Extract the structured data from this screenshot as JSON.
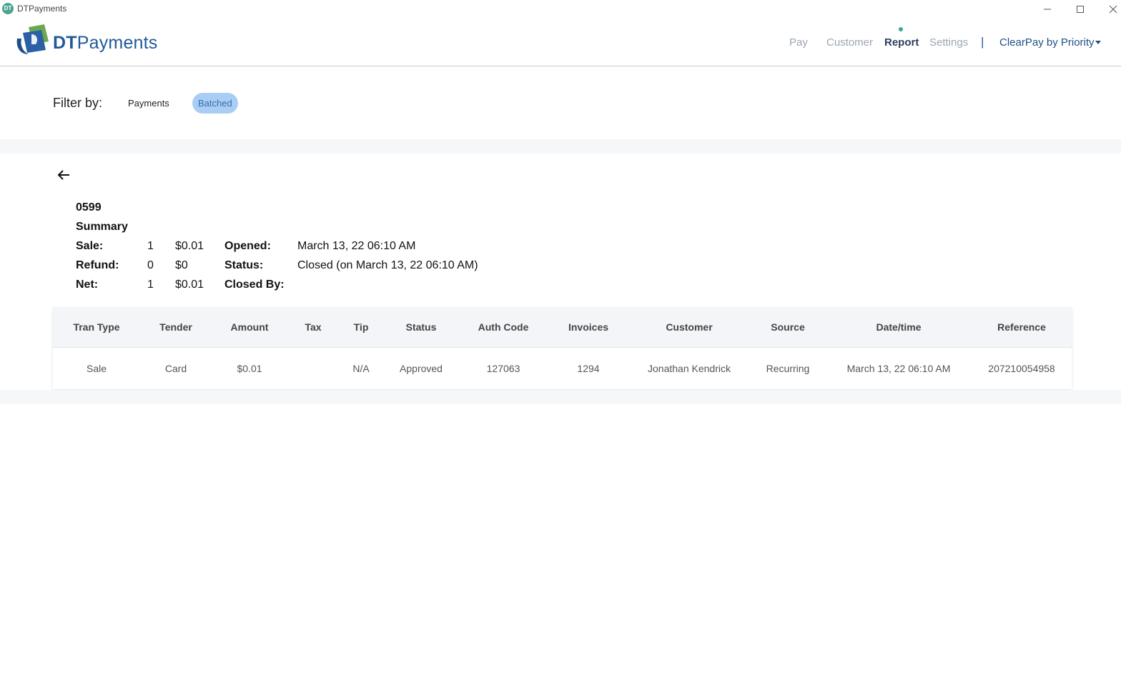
{
  "window": {
    "title": "DTPayments",
    "icon_text": "DT"
  },
  "header": {
    "logo_bold": "DT",
    "logo_rest": "Payments",
    "nav": [
      {
        "label": "Pay",
        "active": false
      },
      {
        "label": "Customer",
        "active": false
      },
      {
        "label": "Report",
        "active": true
      },
      {
        "label": "Settings",
        "active": false
      }
    ],
    "separator": "|",
    "merchant": "ClearPay by Priority"
  },
  "filter": {
    "label": "Filter by:",
    "options": [
      {
        "label": "Payments",
        "selected": false
      },
      {
        "label": "Batched",
        "selected": true
      }
    ]
  },
  "batch": {
    "number": "0599",
    "summary_heading": "Summary",
    "rows": [
      {
        "label": "Sale:",
        "count": "1",
        "amount": "$0.01",
        "field": "Opened:",
        "value": "March 13, 22 06:10 AM"
      },
      {
        "label": "Refund:",
        "count": "0",
        "amount": "$0",
        "field": "Status:",
        "value": "Closed (on March 13, 22 06:10 AM)"
      },
      {
        "label": "Net:",
        "count": "1",
        "amount": "$0.01",
        "field": "Closed By:",
        "value": ""
      }
    ]
  },
  "table": {
    "columns": [
      "Tran Type",
      "Tender",
      "Amount",
      "Tax",
      "Tip",
      "Status",
      "Auth Code",
      "Invoices",
      "Customer",
      "Source",
      "Date/time",
      "Reference"
    ],
    "rows": [
      [
        "Sale",
        "Card",
        "$0.01",
        "",
        "N/A",
        "Approved",
        "127063",
        "1294",
        "Jonathan Kendrick",
        "Recurring",
        "March 13, 22 06:10 AM",
        "207210054958"
      ]
    ]
  },
  "colors": {
    "brand": "#1f5a98",
    "active_chip": "#a9cdf5",
    "nav_dot": "#3aa596"
  }
}
